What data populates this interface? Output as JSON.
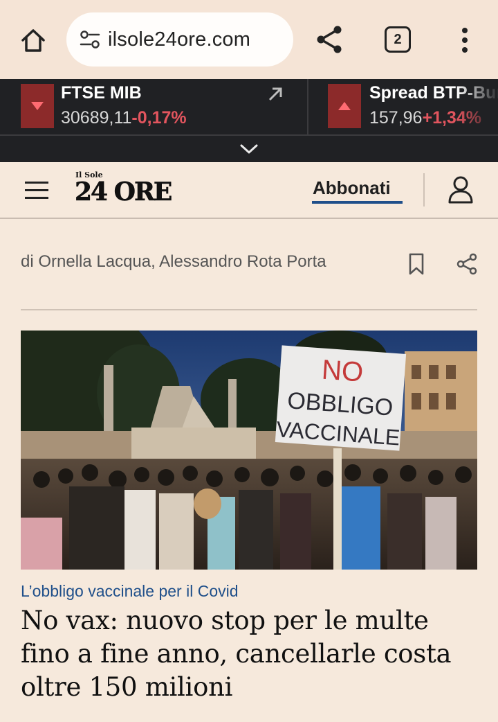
{
  "browser": {
    "url": "ilsole24ore.com",
    "tab_count": "2",
    "icons": [
      "home-icon",
      "site-settings-icon",
      "share-icon",
      "tabs-icon",
      "more-vert-icon"
    ]
  },
  "ticker": {
    "items": [
      {
        "name": "FTSE MIB",
        "value": "30689,11",
        "change": "-0,17%",
        "direction": "down"
      },
      {
        "name": "Spread BTP-Bund",
        "value": "157,96",
        "change": "+1,34%",
        "direction": "up"
      }
    ],
    "colors": {
      "negative": "#e2555e",
      "indicator_bg": "#8c2a2a",
      "bar_bg": "#202124"
    }
  },
  "header": {
    "logo_small": "Il Sole",
    "logo_big": "24 ORE",
    "subscribe_label": "Abbonati",
    "accent_color": "#1f4f8a"
  },
  "article": {
    "byline": "di Ornella Lacqua, Alessandro Rota Porta",
    "photo": {
      "sign_lines": [
        "NO",
        "OBBLIGO",
        "VACCINALE"
      ]
    },
    "kicker": "L’obbligo vaccinale per il Covid",
    "headline": "No vax: nuovo stop per le multe fino a fine anno, cancellarle costa oltre 150 milioni"
  }
}
